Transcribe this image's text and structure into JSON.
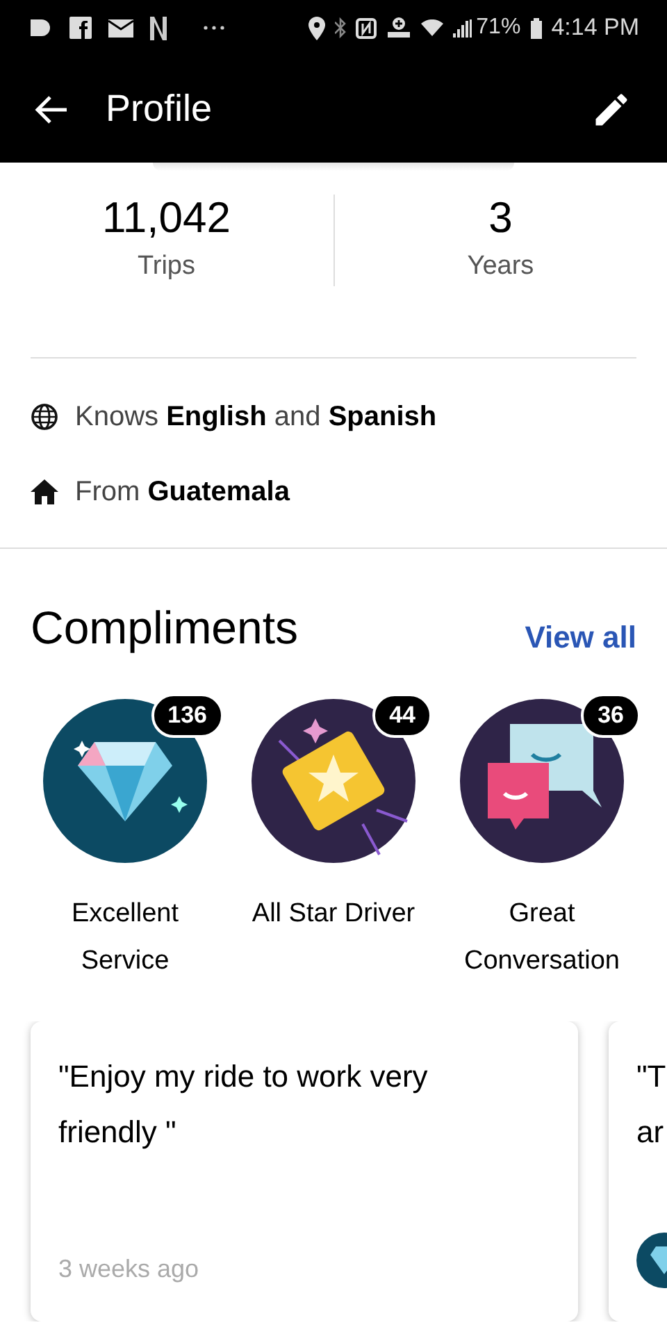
{
  "status_bar": {
    "battery": "71%",
    "time": "4:14 PM"
  },
  "header": {
    "title": "Profile"
  },
  "stats": [
    {
      "value": "11,042",
      "label": "Trips"
    },
    {
      "value": "3",
      "label": "Years"
    }
  ],
  "details": [
    {
      "kind": "language",
      "text": "Knows **English** and **Spanish**"
    },
    {
      "kind": "home",
      "text": "From **Guatemala**"
    }
  ],
  "compliments": {
    "title": "Compliments",
    "link": "View all",
    "items": [
      {
        "kind": "diamond",
        "count": "136",
        "label": "Excellent Service"
      },
      {
        "kind": "ticket",
        "count": "44",
        "label": "All Star Driver"
      },
      {
        "kind": "chat",
        "count": "36",
        "label": "Great Conversation"
      }
    ]
  },
  "comments": [
    {
      "text": "\"Enjoy my ride to work very friendly \"",
      "time": "3 weeks ago"
    },
    {
      "text": "\"T ar"
    }
  ]
}
